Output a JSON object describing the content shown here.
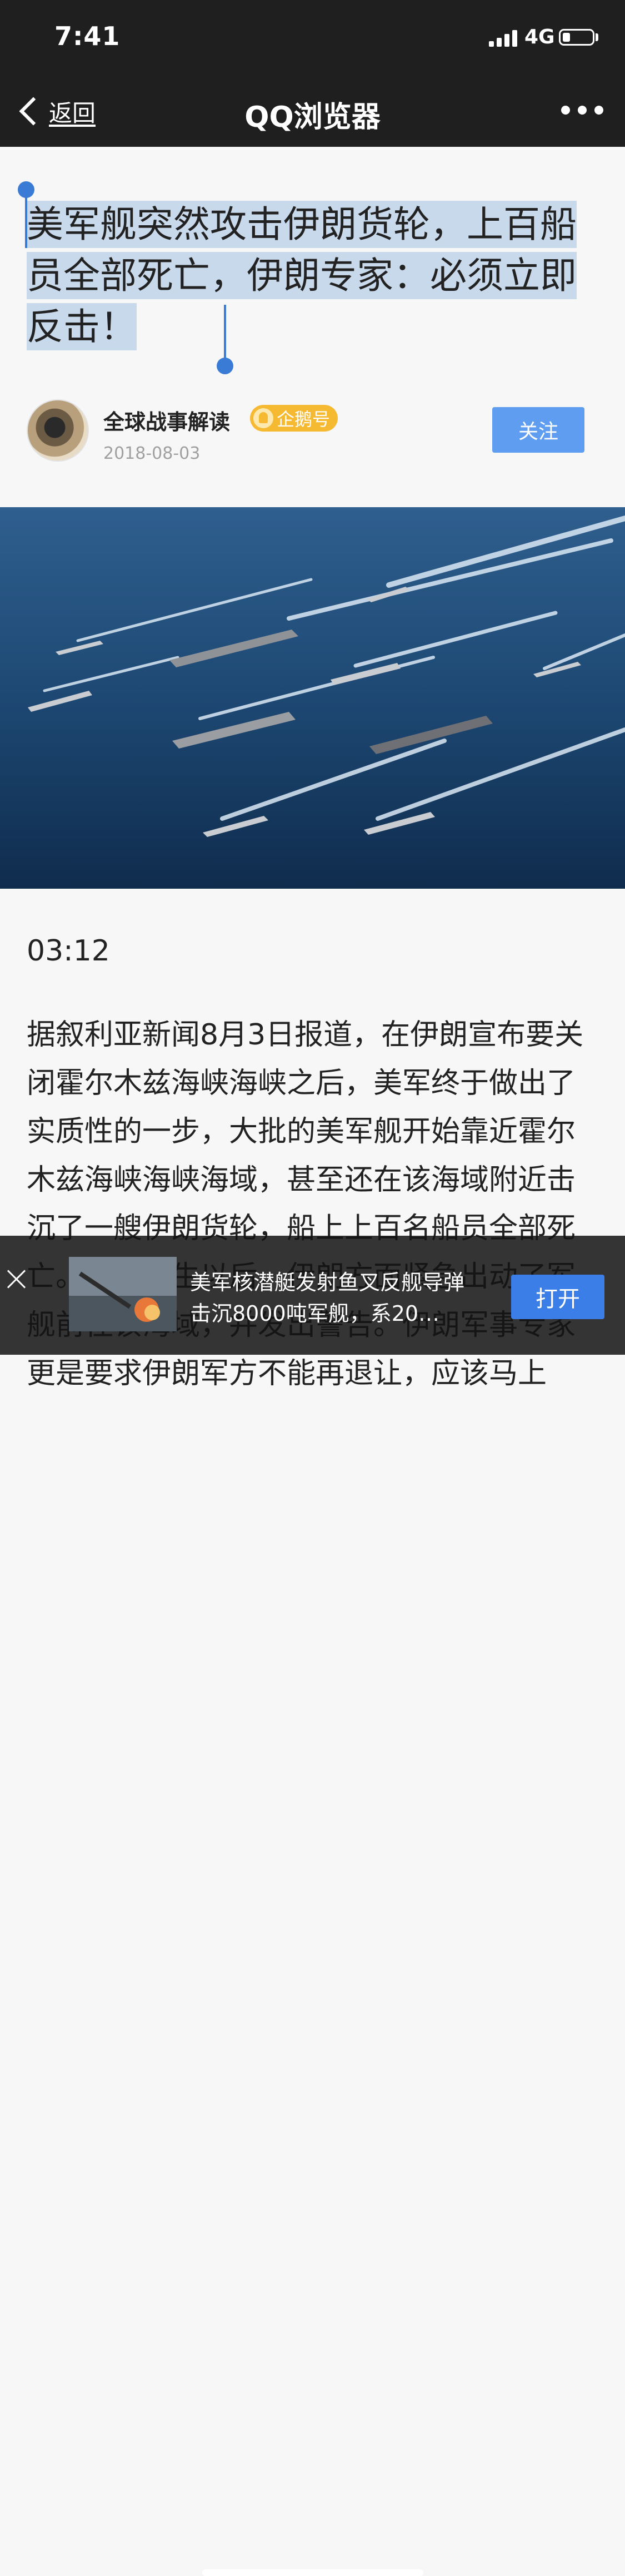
{
  "status_bar": {
    "time": "7:41",
    "network": "4G",
    "battery_level": 0.25
  },
  "nav": {
    "back_label": "返回",
    "title": "QQ浏览器",
    "more_icon": "more-dots-icon"
  },
  "article": {
    "headline": "美军舰突然攻击伊朗货轮，上百船员全部死亡，伊朗专家：必须立即反击！",
    "author": "全球战事解读",
    "badge": "企鹅号",
    "date": "2018-08-03",
    "follow_label": "关注",
    "video_time": "03:12",
    "body": "据叙利亚新闻8月3日报道，在伊朗宣布要关闭霍尔木兹海峡海峡之后，美军终于做出了实质性的一步，大批的美军舰开始靠近霍尔木兹海峡海峡海域，甚至还在该海域附近击沉了一艘伊朗货轮，船上上百名船员全部死亡。事件发生以后，伊朗方面紧急出动了军舰前往该海域，并发出警告。伊朗军事专家更是要求伊朗军方不能再退让，应该马上"
  },
  "ad": {
    "text": "美军核潜艇发射鱼叉反舰导弹击沉8000吨军舰，系20…",
    "open_label": "打开",
    "close_icon": "close-icon"
  },
  "colors": {
    "nav_bg": "#1f1f1f",
    "selection": "#c9d9ec",
    "handle": "#3a7bd5",
    "follow_button": "#5f9df1",
    "badge": "#f5b932",
    "open_button": "#3b7ee8"
  }
}
